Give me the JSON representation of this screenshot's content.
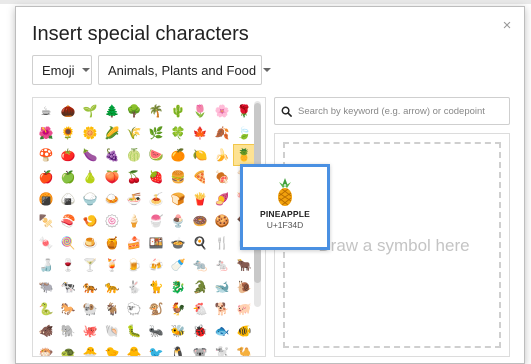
{
  "dialog": {
    "title": "Insert special characters",
    "close_glyph": "×"
  },
  "filters": {
    "category": "Emoji",
    "subcategory": "Animals, Plants and Food"
  },
  "search": {
    "placeholder": "Search by keyword (e.g. arrow) or codepoint"
  },
  "draw": {
    "hint": "Draw a symbol here"
  },
  "preview": {
    "name": "PINEAPPLE",
    "codepoint": "U+1F34D",
    "glyph": "🍍"
  },
  "grid": {
    "selected_index": 29,
    "cells": [
      "☕",
      "🌰",
      "🌱",
      "🌲",
      "🌳",
      "🌴",
      "🌵",
      "🌷",
      "🌸",
      "🌹",
      "🌺",
      "🌻",
      "🌼",
      "🌽",
      "🌾",
      "🌿",
      "🍀",
      "🍁",
      "🍂",
      "🍃",
      "🍄",
      "🍅",
      "🍆",
      "🍇",
      "🍈",
      "🍉",
      "🍊",
      "🍋",
      "🍌",
      "🍍",
      "🍎",
      "🍏",
      "🍐",
      "🍑",
      "🍒",
      "🍓",
      "🍔",
      "🍕",
      "🍖",
      "🍗",
      "🍘",
      "🍙",
      "🍚",
      "🍛",
      "🍜",
      "🍝",
      "🍞",
      "🍟",
      "🍠",
      "🍡",
      "🍢",
      "🍣",
      "🍤",
      "🍥",
      "🍦",
      "🍧",
      "🍨",
      "🍩",
      "🍪",
      "🍫",
      "🍬",
      "🍭",
      "🍮",
      "🍯",
      "🍰",
      "🍱",
      "🍲",
      "🍳",
      "🍴",
      "🍵",
      "🍶",
      "🍷",
      "🍸",
      "🍹",
      "🍺",
      "🍻",
      "🍼",
      "🐀",
      "🐁",
      "🐂",
      "🐃",
      "🐄",
      "🐅",
      "🐆",
      "🐇",
      "🐈",
      "🐉",
      "🐊",
      "🐋",
      "🐌",
      "🐍",
      "🐎",
      "🐏",
      "🐐",
      "🐑",
      "🐒",
      "🐓",
      "🐔",
      "🐕",
      "🐖",
      "🐗",
      "🐘",
      "🐙",
      "🐚",
      "🐛",
      "🐜",
      "🐝",
      "🐞",
      "🐟",
      "🐠",
      "🐡",
      "🐢",
      "🐣",
      "🐤",
      "🐥",
      "🐦",
      "🐧",
      "🐨",
      "🐩",
      "🐪"
    ]
  },
  "colors": {
    "accent": "#4a90e2",
    "selected_cell": "#fde293",
    "border": "#cfcfcf"
  },
  "icons": {
    "search": "search-icon",
    "close": "close-icon",
    "dropdown": "chevron-down-icon"
  }
}
